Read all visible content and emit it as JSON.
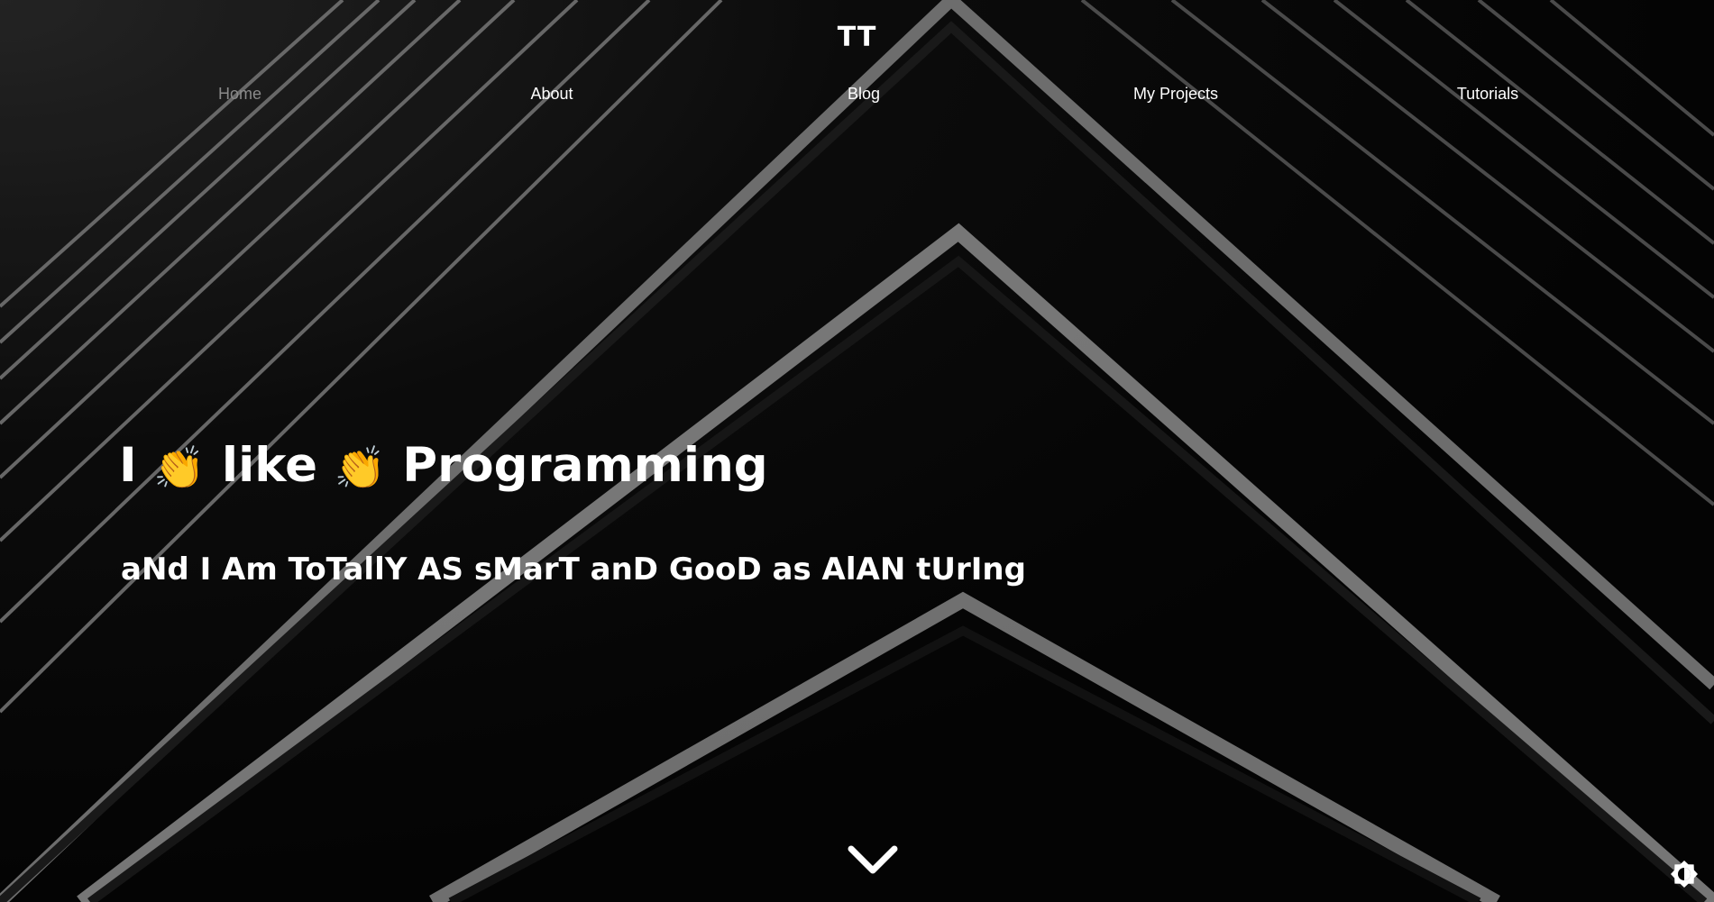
{
  "header": {
    "logo_text": "TT",
    "nav": [
      {
        "label": "Home",
        "active": true
      },
      {
        "label": "About",
        "active": false
      },
      {
        "label": "Blog",
        "active": false
      },
      {
        "label": "My Projects",
        "active": false
      },
      {
        "label": "Tutorials",
        "active": false
      }
    ]
  },
  "hero": {
    "title_part1": "I",
    "title_part2": "like",
    "title_part3": "Programming",
    "title_emoji": "👏",
    "emoji_icon": "clapping-hands-icon",
    "subtitle": "aNd I Am ToTallY AS sMarT anD GooD as AlAN tUrIng"
  },
  "icons": {
    "scroll_down": "chevron-down-icon",
    "theme_toggle": "brightness-icon"
  },
  "colors": {
    "background": "#050505",
    "text": "#ffffff",
    "nav_active": "#8a8a8a",
    "emoji": "#f6c233"
  }
}
